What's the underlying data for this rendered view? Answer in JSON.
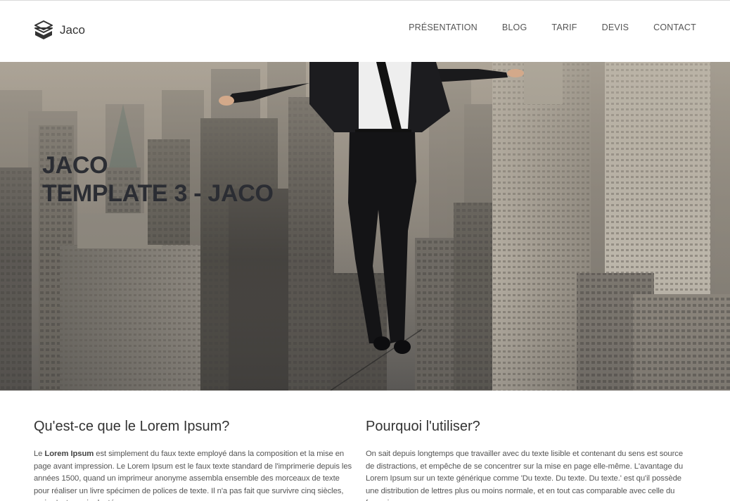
{
  "brand": {
    "name": "Jaco",
    "icon": "cube-logo-icon"
  },
  "nav": {
    "items": [
      "PRÉSENTATION",
      "BLOG",
      "TARIF",
      "DEVIS",
      "CONTACT"
    ]
  },
  "hero": {
    "line1": "JACO",
    "line2": "TEMPLATE 3 - JACO"
  },
  "sections": {
    "left": {
      "title": "Qu'est-ce que le Lorem Ipsum?",
      "lead": "Le ",
      "bold": "Lorem Ipsum",
      "text": " est simplement du faux texte employé dans la composition et la mise en page avant impression. Le Lorem Ipsum est le faux texte standard de l'imprimerie depuis les années 1500, quand un imprimeur anonyme assembla ensemble des morceaux de texte pour réaliser un livre spécimen de polices de texte. Il n'a pas fait que survivre cinq siècles, mais s'est aussi adapté"
    },
    "right": {
      "title": "Pourquoi l'utiliser?",
      "text": "On sait depuis longtemps que travailler avec du texte lisible et contenant du sens est source de distractions, et empêche de se concentrer sur la mise en page elle-même. L'avantage du Lorem Ipsum sur un texte générique comme 'Du texte. Du texte. Du texte.' est qu'il possède une distribution de lettres plus ou moins normale, et en tout cas comparable avec celle du français"
    }
  }
}
